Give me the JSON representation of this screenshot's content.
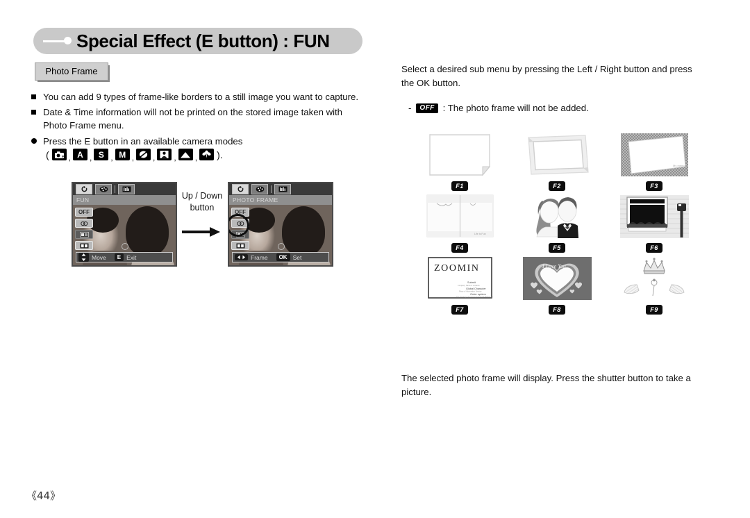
{
  "header": {
    "title": "Special Effect (E button) : FUN",
    "bullet_icon": "dash-dot-icon"
  },
  "section_tab": {
    "label": "Photo Frame"
  },
  "left_column": {
    "bullets": [
      "You can add 9 types of frame-like borders to a still image you want to capture.",
      "Date & Time information will not be printed on the stored image taken with Photo Frame menu.",
      "Press the E button in an available camera modes"
    ],
    "mode_icons": {
      "open_paren": "(",
      "close_paren": ").",
      "separator": ",",
      "items": [
        {
          "name": "program-mode-icon",
          "label": ""
        },
        {
          "name": "aperture-priority-mode-icon",
          "label": "A"
        },
        {
          "name": "shutter-priority-mode-icon",
          "label": "S"
        },
        {
          "name": "manual-mode-icon",
          "label": "M"
        },
        {
          "name": "night-scene-mode-icon",
          "label": ""
        },
        {
          "name": "portrait-mode-icon",
          "label": ""
        },
        {
          "name": "landscape-mode-icon",
          "label": ""
        },
        {
          "name": "macro-mode-icon",
          "label": ""
        }
      ]
    },
    "transition_label_line1": "Up / Down",
    "transition_label_line2": "button",
    "lcd_left": {
      "title": "FUN",
      "tabs": [
        "record-tab-icon",
        "effect-tab-icon",
        "setup-tab-icon"
      ],
      "side_buttons": [
        "OFF",
        "color-effect-icon",
        "highlight-icon",
        "photo-frame-icon"
      ],
      "bottom": [
        {
          "key": "updown-key-icon",
          "text": "Move"
        },
        {
          "key": "E",
          "text": "Exit"
        }
      ]
    },
    "lcd_right": {
      "title": "PHOTO FRAME",
      "tabs": [
        "record-tab-icon",
        "effect-tab-icon",
        "setup-tab-icon"
      ],
      "side_buttons": [
        "OFF",
        "color-effect-icon",
        "highlight-icon",
        "photo-frame-icon"
      ],
      "selected_index": 3,
      "bottom": [
        {
          "key": "leftright-key-icon",
          "text": "Frame"
        },
        {
          "key": "OK",
          "text": "Set"
        }
      ]
    }
  },
  "right_column": {
    "intro_text": "Select a desired sub menu by pressing the Left / Right button and press the OK button.",
    "off_line": {
      "dash": "-",
      "badge": "OFF",
      "text": ": The photo frame will not be added."
    },
    "frames": [
      {
        "badge": "F1",
        "style": "folded-corner-frame"
      },
      {
        "badge": "F2",
        "style": "double-line-frame"
      },
      {
        "badge": "F3",
        "style": "tilted-card-on-texture-frame"
      },
      {
        "badge": "F4",
        "style": "notebook-pages-frame"
      },
      {
        "badge": "F5",
        "style": "couple-silhouette-frame"
      },
      {
        "badge": "F6",
        "style": "window-with-mailbox-frame"
      },
      {
        "badge": "F7",
        "style": "zoomin-card-frame",
        "caption": "ZOOMIN"
      },
      {
        "badge": "F8",
        "style": "heart-frame",
        "caption": "I Love You"
      },
      {
        "badge": "F9",
        "style": "crown-and-wings-frame"
      }
    ],
    "closing_text": "The selected photo frame will display. Press the shutter button to take a picture."
  },
  "footer": {
    "page_number": "《44》"
  }
}
